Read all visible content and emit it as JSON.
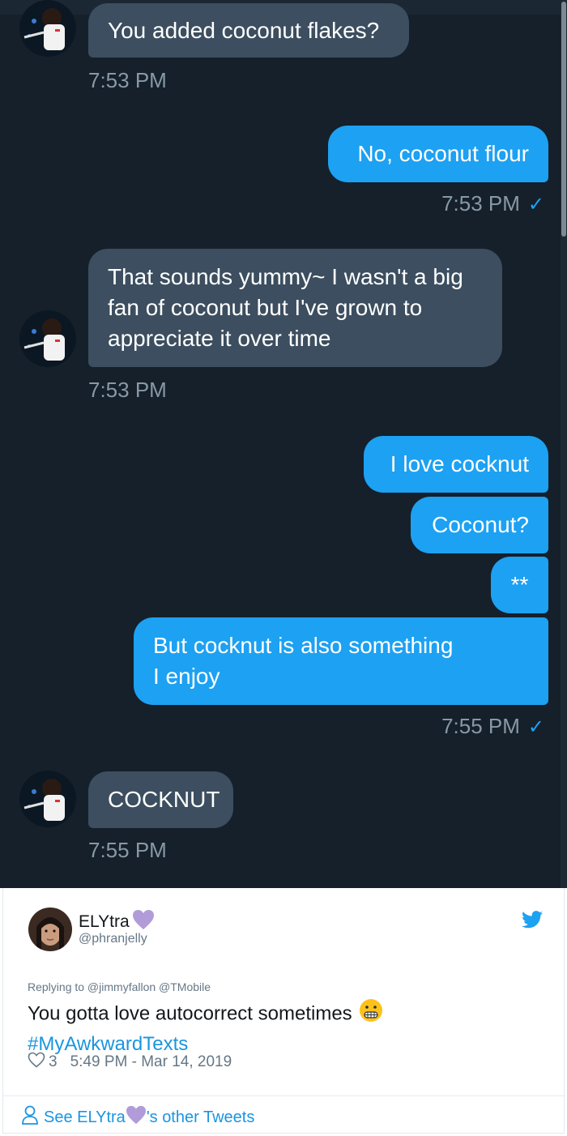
{
  "dm": {
    "messages": [
      {
        "direction": "incoming",
        "lines": [
          "You added coconut flakes?"
        ]
      },
      {
        "direction": "outgoing",
        "lines": [
          "No, coconut flour"
        ]
      },
      {
        "direction": "incoming",
        "lines": [
          "That sounds yummy~ I wasn't a big",
          "fan of coconut but I've grown to",
          "appreciate it over time"
        ]
      },
      {
        "direction": "outgoing",
        "lines": [
          "I love cocknut"
        ]
      },
      {
        "direction": "outgoing",
        "lines": [
          "Coconut?"
        ]
      },
      {
        "direction": "outgoing",
        "lines": [
          "**"
        ]
      },
      {
        "direction": "outgoing",
        "lines": [
          "But cocknut is also something",
          "I enjoy"
        ]
      },
      {
        "direction": "incoming",
        "lines": [
          "COCKNUT"
        ]
      }
    ],
    "timestamps": {
      "t1": "7:53 PM",
      "t2": "7:53 PM",
      "t3": "7:53 PM",
      "t4": "7:55 PM",
      "t5": "7:55 PM"
    },
    "read_check": "✓",
    "colors": {
      "background": "#15202b",
      "incoming": "#3c4e5f",
      "outgoing": "#1da1f2",
      "time": "#8899a6"
    },
    "icons": {
      "contact_avatar": "avatar-photo",
      "read_receipt": "check-icon"
    }
  },
  "tweet": {
    "display_name": "ELYtra",
    "name_emoji": "purple-heart",
    "handle": "@phranjelly",
    "replying_to": "Replying to @jimmyfallon @TMobile",
    "text": "You gotta love autocorrect sometimes",
    "text_emoji": "grimacing-face",
    "hashtag": "#MyAwkwardTexts",
    "like_count": "3",
    "timestamp": "5:49 PM - Mar 14, 2019",
    "see_more_prefix": "See ELYtra",
    "see_more_suffix": "'s other Tweets",
    "colors": {
      "link": "#1b95e0",
      "text": "#14171a",
      "muted": "#657786",
      "heart_emoji": "#b19cd9"
    },
    "icons": {
      "brand": "twitter-bird-icon",
      "like": "heart-outline-icon",
      "profile": "person-icon"
    }
  }
}
